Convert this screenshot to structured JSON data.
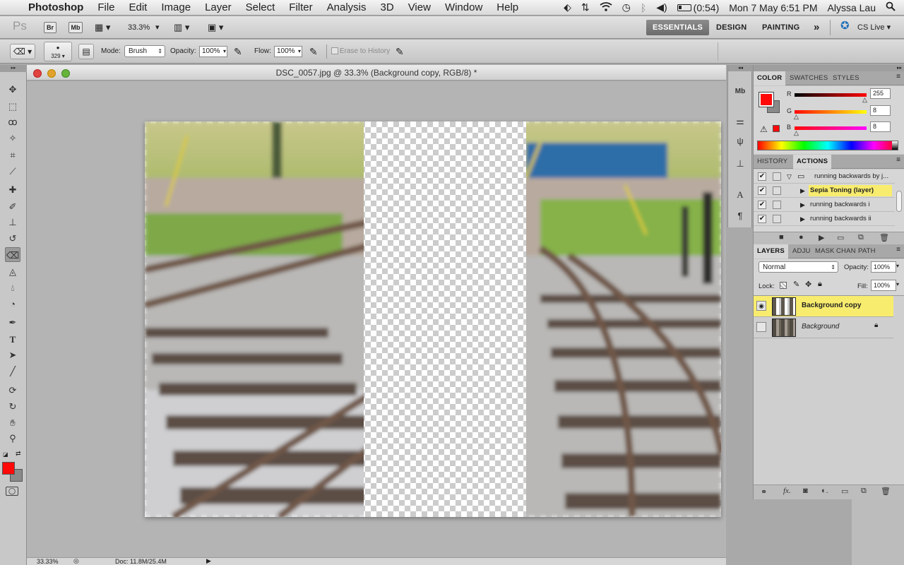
{
  "menubar": {
    "app_name": "Photoshop",
    "menus": [
      "File",
      "Edit",
      "Image",
      "Layer",
      "Select",
      "Filter",
      "Analysis",
      "3D",
      "View",
      "Window",
      "Help"
    ],
    "battery": "(0:54)",
    "datetime": "Mon 7 May  6:51 PM",
    "user": "Alyssa Lau"
  },
  "appbar": {
    "ps_logo": "Ps",
    "bridge": "Br",
    "minibridge": "Mb",
    "zoom": "33.3%",
    "workspaces": [
      "ESSENTIALS",
      "DESIGN",
      "PAINTING"
    ],
    "more": "»",
    "cs_live": "CS Live"
  },
  "options": {
    "brush_size": "329",
    "mode_label": "Mode:",
    "mode_value": "Brush",
    "opacity_label": "Opacity:",
    "opacity_value": "100%",
    "flow_label": "Flow:",
    "flow_value": "100%",
    "erase_history": "Erase to History"
  },
  "document": {
    "title": "DSC_0057.jpg @ 33.3% (Background copy, RGB/8) *",
    "status_zoom": "33.33%",
    "status_doc": "Doc: 11.8M/25.4M"
  },
  "color_panel": {
    "tabs": [
      "COLOR",
      "SWATCHES",
      "STYLES"
    ],
    "r_label": "R",
    "g_label": "G",
    "b_label": "B",
    "r": "255",
    "g": "8",
    "b": "8",
    "r_level": 1.0,
    "g_level": 0.03,
    "b_level": 0.03,
    "fg_color": "#ff0808"
  },
  "actions_panel": {
    "tabs": [
      "HISTORY",
      "ACTIONS"
    ],
    "items": [
      {
        "label": "running backwards by j...",
        "checked": true
      },
      {
        "label": "Sepia Toning (layer)",
        "checked": true
      },
      {
        "label": "running backwards i",
        "checked": true
      },
      {
        "label": "running backwards ii",
        "checked": true
      }
    ]
  },
  "layers_panel": {
    "tabs": [
      "LAYERS",
      "ADJU",
      "MASK",
      "CHAN",
      "PATH"
    ],
    "blend_mode": "Normal",
    "opacity_label": "Opacity:",
    "opacity": "100%",
    "lock_label": "Lock:",
    "fill_label": "Fill:",
    "fill": "100%",
    "layers": [
      {
        "name": "Background copy",
        "visible": true,
        "selected": true
      },
      {
        "name": "Background",
        "visible": false,
        "locked": true
      }
    ]
  }
}
